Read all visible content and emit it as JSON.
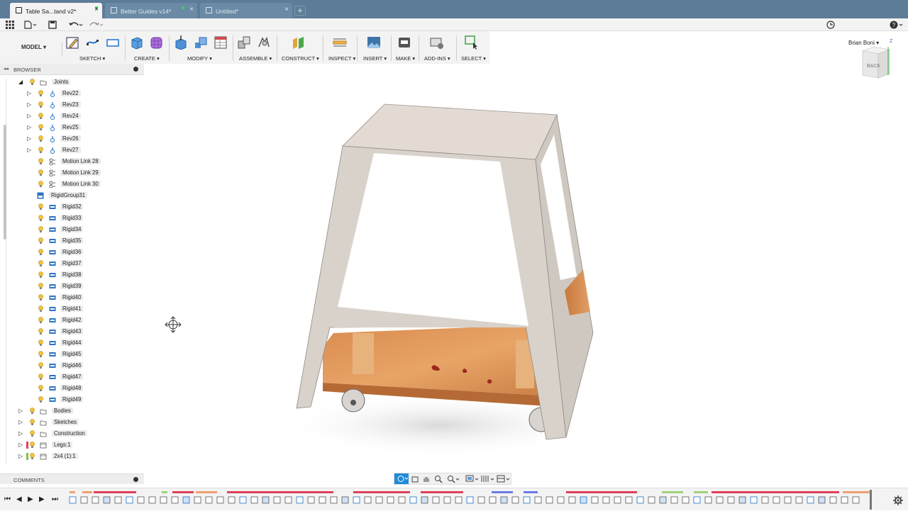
{
  "tabs": [
    {
      "label": "Table Sa...tand v2*",
      "active": true
    },
    {
      "label": "Better Guides v14*",
      "active": false
    },
    {
      "label": "Untitled*",
      "active": false
    }
  ],
  "user": {
    "name": "Brian Boni"
  },
  "toolbar": {
    "workspace": "MODEL",
    "groups": [
      "SKETCH",
      "CREATE",
      "MODIFY",
      "ASSEMBLE",
      "CONSTRUCT",
      "INSPECT",
      "INSERT",
      "MAKE",
      "ADD-INS",
      "SELECT"
    ]
  },
  "browser": {
    "title": "BROWSER",
    "items": [
      {
        "label": "Joints",
        "type": "folder",
        "level": 0,
        "expanded": true
      },
      {
        "label": "Rev22",
        "type": "joint",
        "level": 1
      },
      {
        "label": "Rev23",
        "type": "joint",
        "level": 1
      },
      {
        "label": "Rev24",
        "type": "joint",
        "level": 1
      },
      {
        "label": "Rev25",
        "type": "joint",
        "level": 1
      },
      {
        "label": "Rev26",
        "type": "joint",
        "level": 1
      },
      {
        "label": "Rev27",
        "type": "joint",
        "level": 1
      },
      {
        "label": "Motion Link 28",
        "type": "motion",
        "level": 1
      },
      {
        "label": "Motion Link 29",
        "type": "motion",
        "level": 1
      },
      {
        "label": "Motion Link 30",
        "type": "motion",
        "level": 1
      },
      {
        "label": "RigidGroup31",
        "type": "group",
        "level": 1
      },
      {
        "label": "Rigid32",
        "type": "rigid",
        "level": 1
      },
      {
        "label": "Rigid33",
        "type": "rigid",
        "level": 1
      },
      {
        "label": "Rigid34",
        "type": "rigid",
        "level": 1
      },
      {
        "label": "Rigid35",
        "type": "rigid",
        "level": 1
      },
      {
        "label": "Rigid36",
        "type": "rigid",
        "level": 1
      },
      {
        "label": "Rigid37",
        "type": "rigid",
        "level": 1
      },
      {
        "label": "Rigid38",
        "type": "rigid",
        "level": 1
      },
      {
        "label": "Rigid39",
        "type": "rigid",
        "level": 1
      },
      {
        "label": "Rigid40",
        "type": "rigid",
        "level": 1
      },
      {
        "label": "Rigid41",
        "type": "rigid",
        "level": 1
      },
      {
        "label": "Rigid42",
        "type": "rigid",
        "level": 1
      },
      {
        "label": "Rigid43",
        "type": "rigid",
        "level": 1
      },
      {
        "label": "Rigid44",
        "type": "rigid",
        "level": 1
      },
      {
        "label": "Rigid45",
        "type": "rigid",
        "level": 1
      },
      {
        "label": "Rigid46",
        "type": "rigid",
        "level": 1
      },
      {
        "label": "Rigid47",
        "type": "rigid",
        "level": 1
      },
      {
        "label": "Rigid48",
        "type": "rigid",
        "level": 1
      },
      {
        "label": "Rigid49",
        "type": "rigid",
        "level": 1
      },
      {
        "label": "Bodies",
        "type": "folder",
        "level": 0
      },
      {
        "label": "Sketches",
        "type": "folder",
        "level": 0
      },
      {
        "label": "Construction",
        "type": "folder",
        "level": 0
      },
      {
        "label": "Legs:1",
        "type": "component",
        "level": 0,
        "color": "#e0405a"
      },
      {
        "label": "2x4 (1):1",
        "type": "component",
        "level": 0,
        "color": "#7dc04a"
      }
    ]
  },
  "comments": {
    "title": "COMMENTS"
  },
  "viewcube": {
    "face": "BACK",
    "axis": "Z"
  },
  "colors": {
    "tabbar": "#5d7c97",
    "accent": "#1f8ad6",
    "timeline_red": "#e0405a",
    "timeline_blue": "#6a7de6",
    "timeline_green": "#9fd37a"
  }
}
